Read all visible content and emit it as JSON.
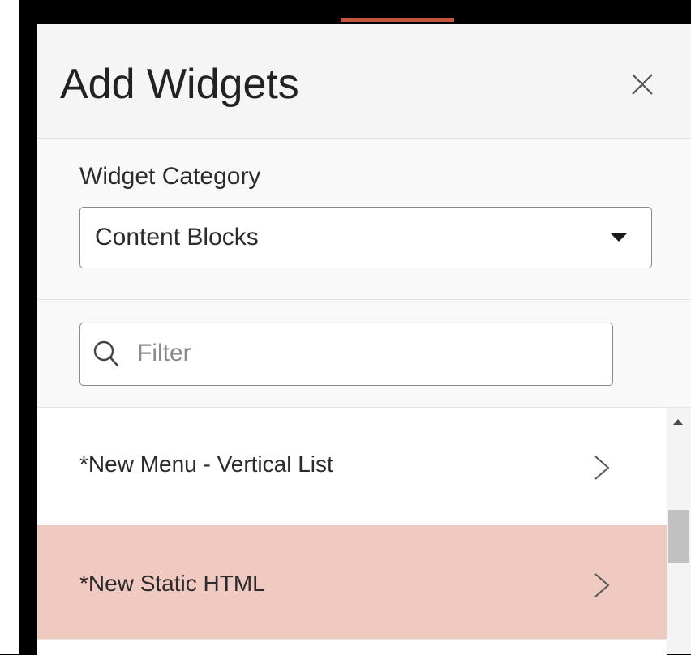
{
  "header": {
    "title": "Add Widgets",
    "close_icon": "close-icon"
  },
  "category": {
    "label": "Widget Category",
    "selected": "Content Blocks"
  },
  "filter": {
    "placeholder": "Filter",
    "value": "",
    "icon": "search-icon"
  },
  "widgets": {
    "items": [
      {
        "label": "*New Menu - Vertical List",
        "selected": false
      },
      {
        "label": "*New Static HTML",
        "selected": true
      }
    ]
  },
  "colors": {
    "accent": "#c4573a",
    "selected_row": "#f0cac0",
    "panel_bg": "#f9f9f9",
    "text": "#2b2b2b"
  }
}
